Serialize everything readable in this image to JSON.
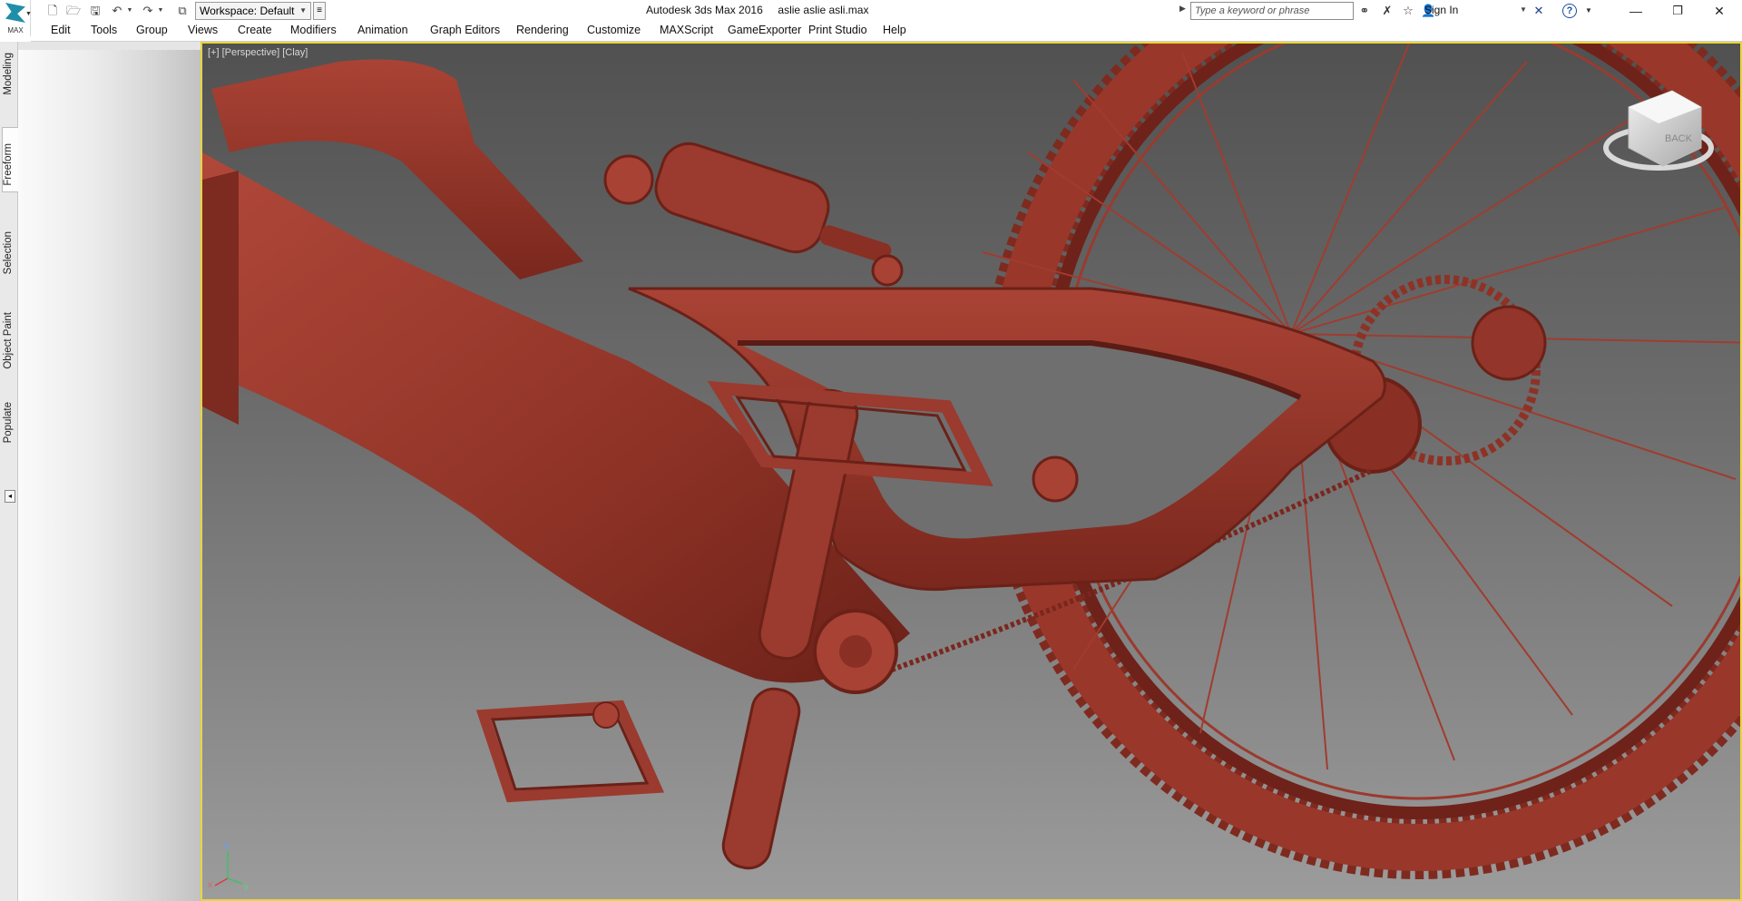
{
  "app": {
    "logo_text": "MAX",
    "workspace_label": "Workspace: Default",
    "title": "Autodesk 3ds Max 2016     aslie aslie asli.max",
    "search_placeholder": "Type a keyword or phrase",
    "sign_in": "Sign In"
  },
  "menu": [
    "Edit",
    "Tools",
    "Group",
    "Views",
    "Create",
    "Modifiers",
    "Animation",
    "Graph Editors",
    "Rendering",
    "Customize",
    "MAXScript",
    "GameExporter",
    "Print Studio",
    "Help"
  ],
  "ribbon_tabs": [
    "Modeling",
    "Freeform",
    "Selection",
    "Object Paint",
    "Populate"
  ],
  "viewport": {
    "label": "[+] [Perspective] [Clay]",
    "viewcube_face": "BACK",
    "axis_x": "x",
    "axis_y": "y",
    "axis_z": "z"
  },
  "colors": {
    "viewport_border": "#e8d53c",
    "clay": "#9b3a2e",
    "logo": "#1f8fa8"
  }
}
